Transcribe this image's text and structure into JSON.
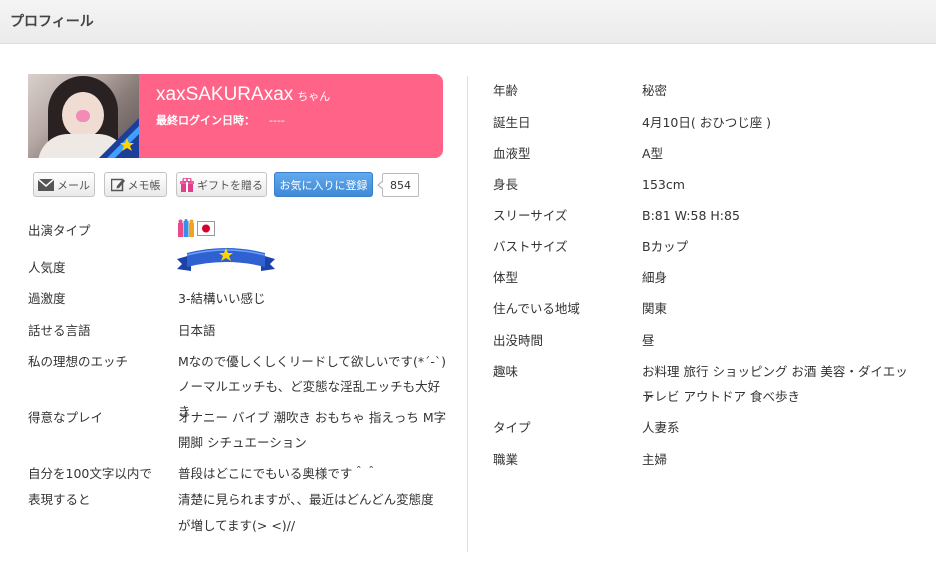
{
  "header": {
    "title": "プロフィール"
  },
  "profile": {
    "name": "xaxSAKURAxax",
    "honorific": "ちゃん",
    "last_login_label": "最終ログイン日時：",
    "last_login_value": "----"
  },
  "actions": {
    "mail_label": "メール",
    "memo_label": "メモ帳",
    "gift_label": "ギフトを贈る",
    "favorite_label": "お気に入りに登録",
    "favorite_count": "854"
  },
  "details_left": [
    {
      "label": "出演タイプ",
      "value": ""
    },
    {
      "label": "人気度",
      "value": ""
    },
    {
      "label": "過激度",
      "value": "3-結構いい感じ"
    },
    {
      "label": "話せる言語",
      "value": "日本語"
    },
    {
      "label": "私の理想のエッチ",
      "value_lines": [
        "Mなので優しくしくリードして欲しいです(*´-`)",
        "ノーマルエッチも、ど変態な淫乱エッチも大好き"
      ]
    },
    {
      "label": "得意なプレイ",
      "value_lines": [
        "オナニー バイブ 潮吹き おもちゃ 指えっち M字",
        "開脚 シチュエーション"
      ]
    },
    {
      "label_lines": [
        "自分を100文字以内で",
        "表現すると"
      ],
      "value_lines": [
        "普段はどこにでもいる奥様です＾＾",
        "清楚に見られますが、、最近はどんどん変態度",
        "が増してます(> <)//"
      ]
    }
  ],
  "details_right": [
    {
      "label": "年齢",
      "value": "秘密"
    },
    {
      "label": "誕生日",
      "value": "4月10日( おひつじ座 )"
    },
    {
      "label": "血液型",
      "value": "A型"
    },
    {
      "label": "身長",
      "value": "153cm"
    },
    {
      "label": "スリーサイズ",
      "value": "B:81 W:58 H:85"
    },
    {
      "label": "バストサイズ",
      "value": "Bカップ"
    },
    {
      "label": "体型",
      "value": "細身"
    },
    {
      "label": "住んでいる地域",
      "value": "関東"
    },
    {
      "label": "出没時間",
      "value": "昼"
    },
    {
      "label": "趣味",
      "value_lines": [
        "お料理 旅行 ショッピング お酒 美容・ダイエット",
        "テレビ アウトドア 食べ歩き"
      ]
    },
    {
      "label": "タイプ",
      "value": "人妻系"
    },
    {
      "label": "職業",
      "value": "主婦"
    }
  ],
  "icons": {
    "mail": "envelope-icon",
    "memo": "pencil-icon",
    "gift": "gift-icon",
    "rank": "rank-star-badge-icon",
    "type_icons": [
      "group-type-icon",
      "japan-flag-icon"
    ],
    "popularity": "star-ribbon-icon"
  },
  "colors": {
    "name_panel": "#ff6388",
    "favorite_button": "#4a95e0",
    "ribbon": "#2a5fc8"
  }
}
